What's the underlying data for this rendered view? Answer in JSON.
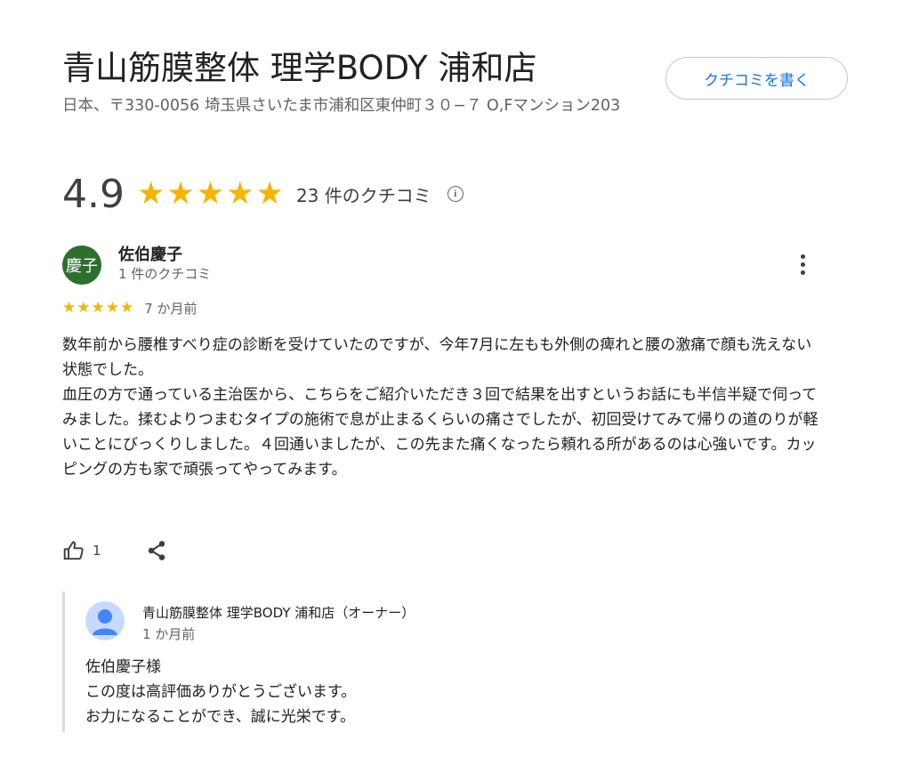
{
  "place": {
    "title": "青山筋膜整体 理学BODY 浦和店",
    "address": "日本、〒330-0056 埼玉県さいたま市浦和区東仲町３０−７ O,Fマンション203",
    "write_review_label": "クチコミを書く"
  },
  "summary": {
    "rating": "4.9",
    "stars": 5,
    "review_count": "23 件のクチコミ",
    "info_glyph": "i"
  },
  "review": {
    "avatar_text": "慶子",
    "reviewer_name": "佐伯慶子",
    "reviewer_review_count": "1 件のクチコミ",
    "stars": 5,
    "date": "7 か月前",
    "text": "数年前から腰椎すべり症の診断を受けていたのですが、今年7月に左もも外側の痺れと腰の激痛で顔も洗えない状態でした。\n血圧の方で通っている主治医から、こちらをご紹介いただき３回で結果を出すというお話にも半信半疑で伺ってみました。揉むよりつまむタイプの施術で息が止まるくらいの痛さでしたが、初回受けてみて帰りの道のりが軽いことにびっくりしました。４回通いましたが、この先また痛くなったら頼れる所があるのは心強いです。カッピングの方も家で頑張ってやってみます。",
    "like_count": "1"
  },
  "owner_reply": {
    "name": "青山筋膜整体 理学BODY 浦和店（オーナー）",
    "date": "1 か月前",
    "text": "佐伯慶子様\nこの度は高評価ありがとうございます。\nお力になることができ、誠に光栄です。"
  },
  "colors": {
    "star": "#f4b400",
    "link": "#1a73e8",
    "reviewer_avatar_bg": "#2e6e2e",
    "owner_avatar_bg": "#c6dafc",
    "owner_avatar_fg": "#4285f4"
  },
  "icons": {
    "info": "info-icon",
    "more": "more-vert-icon",
    "like": "thumb-up-icon",
    "share": "share-icon",
    "owner_avatar": "default-profile-icon"
  }
}
